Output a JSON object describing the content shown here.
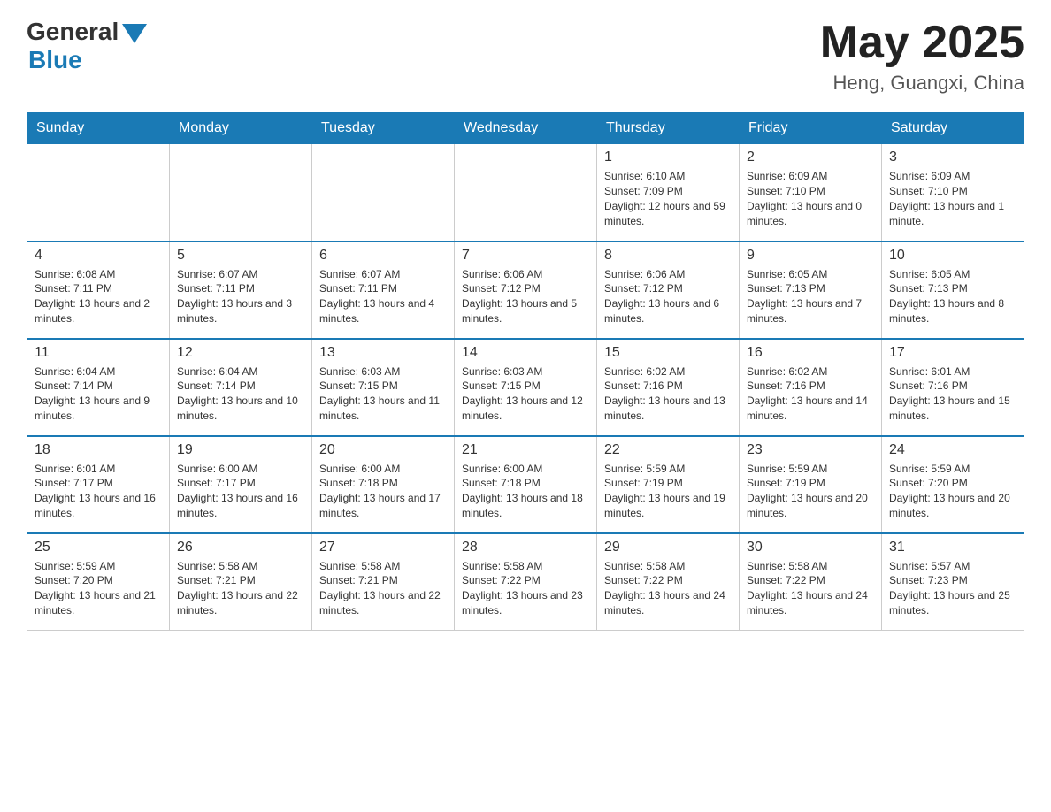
{
  "header": {
    "logo_general": "General",
    "logo_blue": "Blue",
    "month_title": "May 2025",
    "location": "Heng, Guangxi, China"
  },
  "days_of_week": [
    "Sunday",
    "Monday",
    "Tuesday",
    "Wednesday",
    "Thursday",
    "Friday",
    "Saturday"
  ],
  "weeks": [
    [
      {
        "day": "",
        "sunrise": "",
        "sunset": "",
        "daylight": ""
      },
      {
        "day": "",
        "sunrise": "",
        "sunset": "",
        "daylight": ""
      },
      {
        "day": "",
        "sunrise": "",
        "sunset": "",
        "daylight": ""
      },
      {
        "day": "",
        "sunrise": "",
        "sunset": "",
        "daylight": ""
      },
      {
        "day": "1",
        "sunrise": "Sunrise: 6:10 AM",
        "sunset": "Sunset: 7:09 PM",
        "daylight": "Daylight: 12 hours and 59 minutes."
      },
      {
        "day": "2",
        "sunrise": "Sunrise: 6:09 AM",
        "sunset": "Sunset: 7:10 PM",
        "daylight": "Daylight: 13 hours and 0 minutes."
      },
      {
        "day": "3",
        "sunrise": "Sunrise: 6:09 AM",
        "sunset": "Sunset: 7:10 PM",
        "daylight": "Daylight: 13 hours and 1 minute."
      }
    ],
    [
      {
        "day": "4",
        "sunrise": "Sunrise: 6:08 AM",
        "sunset": "Sunset: 7:11 PM",
        "daylight": "Daylight: 13 hours and 2 minutes."
      },
      {
        "day": "5",
        "sunrise": "Sunrise: 6:07 AM",
        "sunset": "Sunset: 7:11 PM",
        "daylight": "Daylight: 13 hours and 3 minutes."
      },
      {
        "day": "6",
        "sunrise": "Sunrise: 6:07 AM",
        "sunset": "Sunset: 7:11 PM",
        "daylight": "Daylight: 13 hours and 4 minutes."
      },
      {
        "day": "7",
        "sunrise": "Sunrise: 6:06 AM",
        "sunset": "Sunset: 7:12 PM",
        "daylight": "Daylight: 13 hours and 5 minutes."
      },
      {
        "day": "8",
        "sunrise": "Sunrise: 6:06 AM",
        "sunset": "Sunset: 7:12 PM",
        "daylight": "Daylight: 13 hours and 6 minutes."
      },
      {
        "day": "9",
        "sunrise": "Sunrise: 6:05 AM",
        "sunset": "Sunset: 7:13 PM",
        "daylight": "Daylight: 13 hours and 7 minutes."
      },
      {
        "day": "10",
        "sunrise": "Sunrise: 6:05 AM",
        "sunset": "Sunset: 7:13 PM",
        "daylight": "Daylight: 13 hours and 8 minutes."
      }
    ],
    [
      {
        "day": "11",
        "sunrise": "Sunrise: 6:04 AM",
        "sunset": "Sunset: 7:14 PM",
        "daylight": "Daylight: 13 hours and 9 minutes."
      },
      {
        "day": "12",
        "sunrise": "Sunrise: 6:04 AM",
        "sunset": "Sunset: 7:14 PM",
        "daylight": "Daylight: 13 hours and 10 minutes."
      },
      {
        "day": "13",
        "sunrise": "Sunrise: 6:03 AM",
        "sunset": "Sunset: 7:15 PM",
        "daylight": "Daylight: 13 hours and 11 minutes."
      },
      {
        "day": "14",
        "sunrise": "Sunrise: 6:03 AM",
        "sunset": "Sunset: 7:15 PM",
        "daylight": "Daylight: 13 hours and 12 minutes."
      },
      {
        "day": "15",
        "sunrise": "Sunrise: 6:02 AM",
        "sunset": "Sunset: 7:16 PM",
        "daylight": "Daylight: 13 hours and 13 minutes."
      },
      {
        "day": "16",
        "sunrise": "Sunrise: 6:02 AM",
        "sunset": "Sunset: 7:16 PM",
        "daylight": "Daylight: 13 hours and 14 minutes."
      },
      {
        "day": "17",
        "sunrise": "Sunrise: 6:01 AM",
        "sunset": "Sunset: 7:16 PM",
        "daylight": "Daylight: 13 hours and 15 minutes."
      }
    ],
    [
      {
        "day": "18",
        "sunrise": "Sunrise: 6:01 AM",
        "sunset": "Sunset: 7:17 PM",
        "daylight": "Daylight: 13 hours and 16 minutes."
      },
      {
        "day": "19",
        "sunrise": "Sunrise: 6:00 AM",
        "sunset": "Sunset: 7:17 PM",
        "daylight": "Daylight: 13 hours and 16 minutes."
      },
      {
        "day": "20",
        "sunrise": "Sunrise: 6:00 AM",
        "sunset": "Sunset: 7:18 PM",
        "daylight": "Daylight: 13 hours and 17 minutes."
      },
      {
        "day": "21",
        "sunrise": "Sunrise: 6:00 AM",
        "sunset": "Sunset: 7:18 PM",
        "daylight": "Daylight: 13 hours and 18 minutes."
      },
      {
        "day": "22",
        "sunrise": "Sunrise: 5:59 AM",
        "sunset": "Sunset: 7:19 PM",
        "daylight": "Daylight: 13 hours and 19 minutes."
      },
      {
        "day": "23",
        "sunrise": "Sunrise: 5:59 AM",
        "sunset": "Sunset: 7:19 PM",
        "daylight": "Daylight: 13 hours and 20 minutes."
      },
      {
        "day": "24",
        "sunrise": "Sunrise: 5:59 AM",
        "sunset": "Sunset: 7:20 PM",
        "daylight": "Daylight: 13 hours and 20 minutes."
      }
    ],
    [
      {
        "day": "25",
        "sunrise": "Sunrise: 5:59 AM",
        "sunset": "Sunset: 7:20 PM",
        "daylight": "Daylight: 13 hours and 21 minutes."
      },
      {
        "day": "26",
        "sunrise": "Sunrise: 5:58 AM",
        "sunset": "Sunset: 7:21 PM",
        "daylight": "Daylight: 13 hours and 22 minutes."
      },
      {
        "day": "27",
        "sunrise": "Sunrise: 5:58 AM",
        "sunset": "Sunset: 7:21 PM",
        "daylight": "Daylight: 13 hours and 22 minutes."
      },
      {
        "day": "28",
        "sunrise": "Sunrise: 5:58 AM",
        "sunset": "Sunset: 7:22 PM",
        "daylight": "Daylight: 13 hours and 23 minutes."
      },
      {
        "day": "29",
        "sunrise": "Sunrise: 5:58 AM",
        "sunset": "Sunset: 7:22 PM",
        "daylight": "Daylight: 13 hours and 24 minutes."
      },
      {
        "day": "30",
        "sunrise": "Sunrise: 5:58 AM",
        "sunset": "Sunset: 7:22 PM",
        "daylight": "Daylight: 13 hours and 24 minutes."
      },
      {
        "day": "31",
        "sunrise": "Sunrise: 5:57 AM",
        "sunset": "Sunset: 7:23 PM",
        "daylight": "Daylight: 13 hours and 25 minutes."
      }
    ]
  ]
}
